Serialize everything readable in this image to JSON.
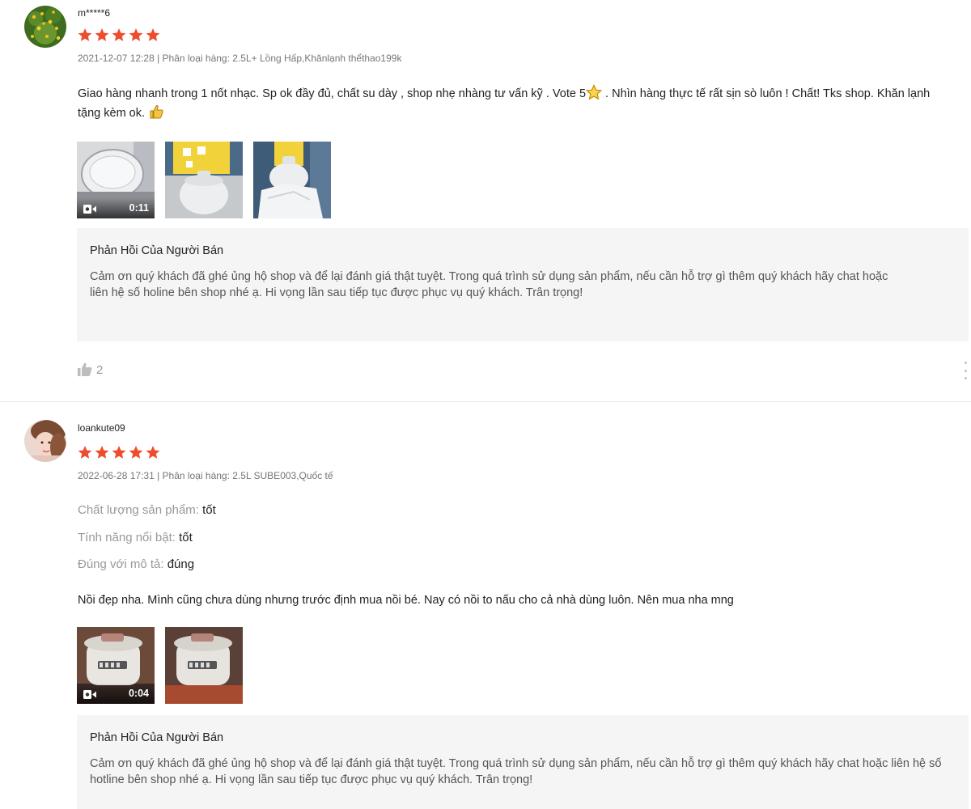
{
  "reviews": [
    {
      "username": "m*****6",
      "rating": 5,
      "meta": "2021-12-07 12:28 | Phân loại hàng: 2.5L+ Lồng Hấp,Khănlạnh thểthao199k",
      "comment_part1": "Giao hàng nhanh trong 1 nốt nhạc. Sp ok đầy đủ, chất su dày , shop nhẹ nhàng tư vấn kỹ . Vote 5",
      "comment_part2": " . Nhìn hàng thực tế rất sịn sò luôn ! Chất! Tks shop. Khăn lạnh tặng kèm ok. ",
      "inline_icons": [
        "star-emoji-icon",
        "thumbs-up-emoji-icon"
      ],
      "media": [
        {
          "type": "video",
          "duration": "0:11"
        },
        {
          "type": "image"
        },
        {
          "type": "image"
        }
      ],
      "reply_title": "Phản Hồi Của Người Bán",
      "reply_text": "Cảm ơn quý khách đã ghé ủng hộ shop và để lại đánh giá thật tuyệt. Trong quá trình sử dụng sản phẩm, nếu cần hỗ trợ gì thêm quý khách hãy chat hoặc\nliên hệ số holine bên shop nhé ạ. Hi vọng lần sau tiếp tục được phục vụ quý khách. Trân trọng!",
      "likes": "2"
    },
    {
      "username": "loankute09",
      "rating": 5,
      "meta": "2022-06-28 17:31 | Phân loại hàng: 2.5L SUBE003,Quốc tế",
      "attributes": [
        {
          "label": "Chất lượng sản phẩm:",
          "value": "tốt"
        },
        {
          "label": "Tính năng nổi bật:",
          "value": "tốt"
        },
        {
          "label": "Đúng với mô tả:",
          "value": "đúng"
        }
      ],
      "comment": "Nồi đẹp nha. Mình cũng chưa dùng nhưng trước định mua nồi bé. Nay có nồi to nấu cho cả nhà dùng luôn. Nên mua nha mng",
      "media": [
        {
          "type": "video",
          "duration": "0:04"
        },
        {
          "type": "image"
        }
      ],
      "reply_title": "Phản Hồi Của Người Bán",
      "reply_text": "Cảm ơn quý khách đã ghé ủng hộ shop và để lại đánh giá thật tuyệt. Trong quá trình sử dụng sản phẩm, nếu cần hỗ trợ gì thêm quý khách hãy chat hoặc liên hệ số hotline bên shop nhé ạ. Hi vọng lần sau tiếp tục được phục vụ quý khách. Trân trọng!"
    }
  ],
  "colors": {
    "star": "#ee4d2d",
    "reply_bg": "#f5f5f5",
    "meta_text": "#767676"
  }
}
